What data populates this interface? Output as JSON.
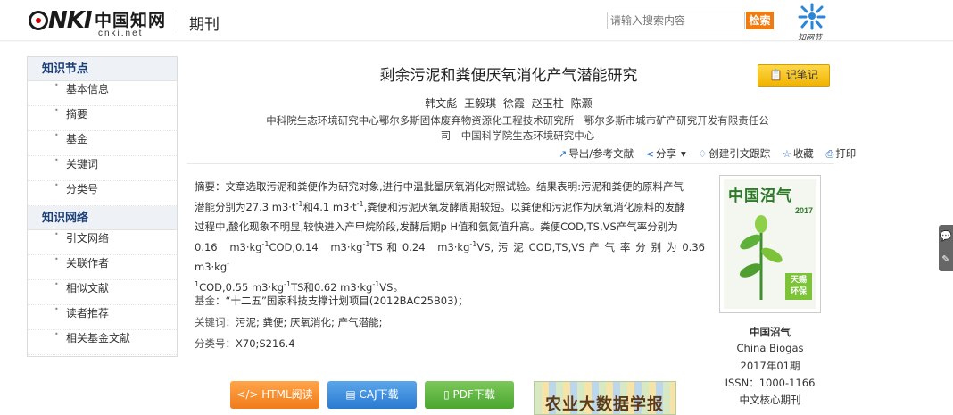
{
  "header": {
    "logo_text": "CNKI",
    "logo_cn": "中国知网",
    "logo_url": "cnki.net",
    "section": "期刊",
    "search_placeholder": "请输入搜索内容",
    "search_button": "检索",
    "zw_label": "知网节"
  },
  "sidebar": {
    "sections": [
      {
        "title": "知识节点",
        "items": [
          "基本信息",
          "摘要",
          "基金",
          "关键词",
          "分类号"
        ]
      },
      {
        "title": "知识网络",
        "items": [
          "引文网络",
          "关联作者",
          "相似文献",
          "读者推荐",
          "相关基金文献"
        ]
      }
    ]
  },
  "paper": {
    "title": "剩余污泥和粪便厌氧消化产气潜能研究",
    "note_button": "记笔记",
    "authors": [
      "韩文彪",
      "王毅琪",
      "徐霞",
      "赵玉柱",
      "陈灏"
    ],
    "org_line1": "中科院生态环境研究中心鄂尔多斯固体废弃物资源化工程技术研究所　鄂尔多斯市城市矿产研究开发有限责任公",
    "org_line2": "司　中国科学院生态环境研究中心"
  },
  "tools": {
    "export": "导出/参考文献",
    "share": "分享",
    "trace": "创建引文跟踪",
    "favorite": "收藏",
    "print": "打印"
  },
  "abstract": {
    "label": "摘要：",
    "line1": "文章选取污泥和粪便作为研究对象,进行中温批量厌氧消化对照试验。结果表明:污泥和粪便的原料产气",
    "line2_a": "潜能分别为27.3 m3·t",
    "line2_sup1": "-1",
    "line2_b": "和4.1 m3·t",
    "line2_sup2": "-1",
    "line2_c": ",粪便和污泥厌氧发酵周期较短。以粪便和污泥作为厌氧消化原料的发酵",
    "line3": "过程中,酸化现象不明显,较快进入产甲烷阶段,发酵后期p H值和氨氮值升高。粪便COD,TS,VS产气率分别为",
    "line4_a": "0.16　m3·kg",
    "line4_sup1": "-1",
    "line4_b": "COD,0.14　m3·kg",
    "line4_sup2": "-1",
    "line4_c": "TS 和 0.24　m3·kg",
    "line4_sup3": "-1",
    "line4_d": "VS, 污 泥 COD,TS,VS 产 气 率 分 别 为 0.36　m3·kg",
    "line4_sup4": "-",
    "line5_sup0": "1",
    "line5_a": "COD,0.55 m3·kg",
    "line5_sup1": "-1",
    "line5_b": "TS和0.62 m3·kg",
    "line5_sup2": "-1",
    "line5_c": "VS。"
  },
  "meta": {
    "fund_label": "基金：",
    "fund_value": "“十二五”国家科技支撑计划项目(2012BAC25B03)；",
    "keywords_label": "关键词：",
    "keywords_value": "污泥; 粪便; 厌氧消化; 产气潜能;",
    "class_label": "分类号：",
    "class_value": "X70;S216.4"
  },
  "downloads": {
    "html": "HTML阅读",
    "caj": "CAJ下载",
    "pdf": "PDF下载",
    "ad_text": "农业大数据学报"
  },
  "journal": {
    "cover_title": "中国沼气",
    "cover_year": "2017",
    "cover_tag": "天赐 环保",
    "name_cn": "中国沼气",
    "name_en": "China Biogas",
    "issue": "2017年01期",
    "issn": "ISSN：1000-1166",
    "core": "中文核心期刊"
  },
  "colors": {
    "accent_orange": "#f07b10",
    "sidebar_head": "#1c3e78",
    "note_yellow": "#f0b400"
  }
}
